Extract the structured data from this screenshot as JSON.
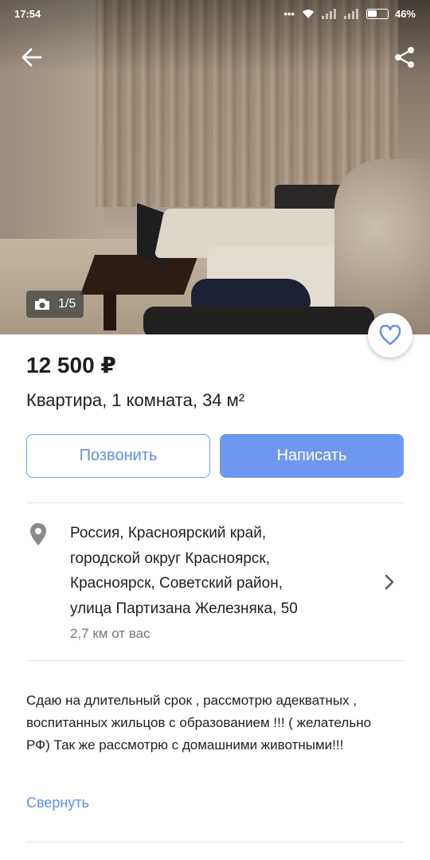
{
  "status_bar": {
    "time": "17:54",
    "battery": "46%"
  },
  "photo": {
    "counter": "1/5"
  },
  "listing": {
    "price": "12 500 ₽",
    "title": "Квартира, 1 комната, 34 м²"
  },
  "actions": {
    "call_label": "Позвонить",
    "write_label": "Написать"
  },
  "address": {
    "lines": [
      "Россия, Красноярский край,",
      "городской округ Красноярск,",
      "Красноярск, Советский район,",
      "улица Партизана Железняка, 50"
    ],
    "distance": "2,7 км от вас"
  },
  "description": {
    "text": "Сдаю на длительный срок , рассмотрю адекватных , воспитанных жильцов с образованием !!! ( желательно РФ) Так же рассмотрю с домашними животными!!!",
    "collapse_label": "Свернуть"
  },
  "colors": {
    "accent": "#6f98f0",
    "link": "#5f8fe9"
  },
  "icons": [
    "back-arrow-icon",
    "share-icon",
    "camera-icon",
    "heart-icon",
    "location-pin-icon",
    "chevron-right-icon",
    "wifi-icon",
    "signal-icon",
    "battery-icon"
  ]
}
